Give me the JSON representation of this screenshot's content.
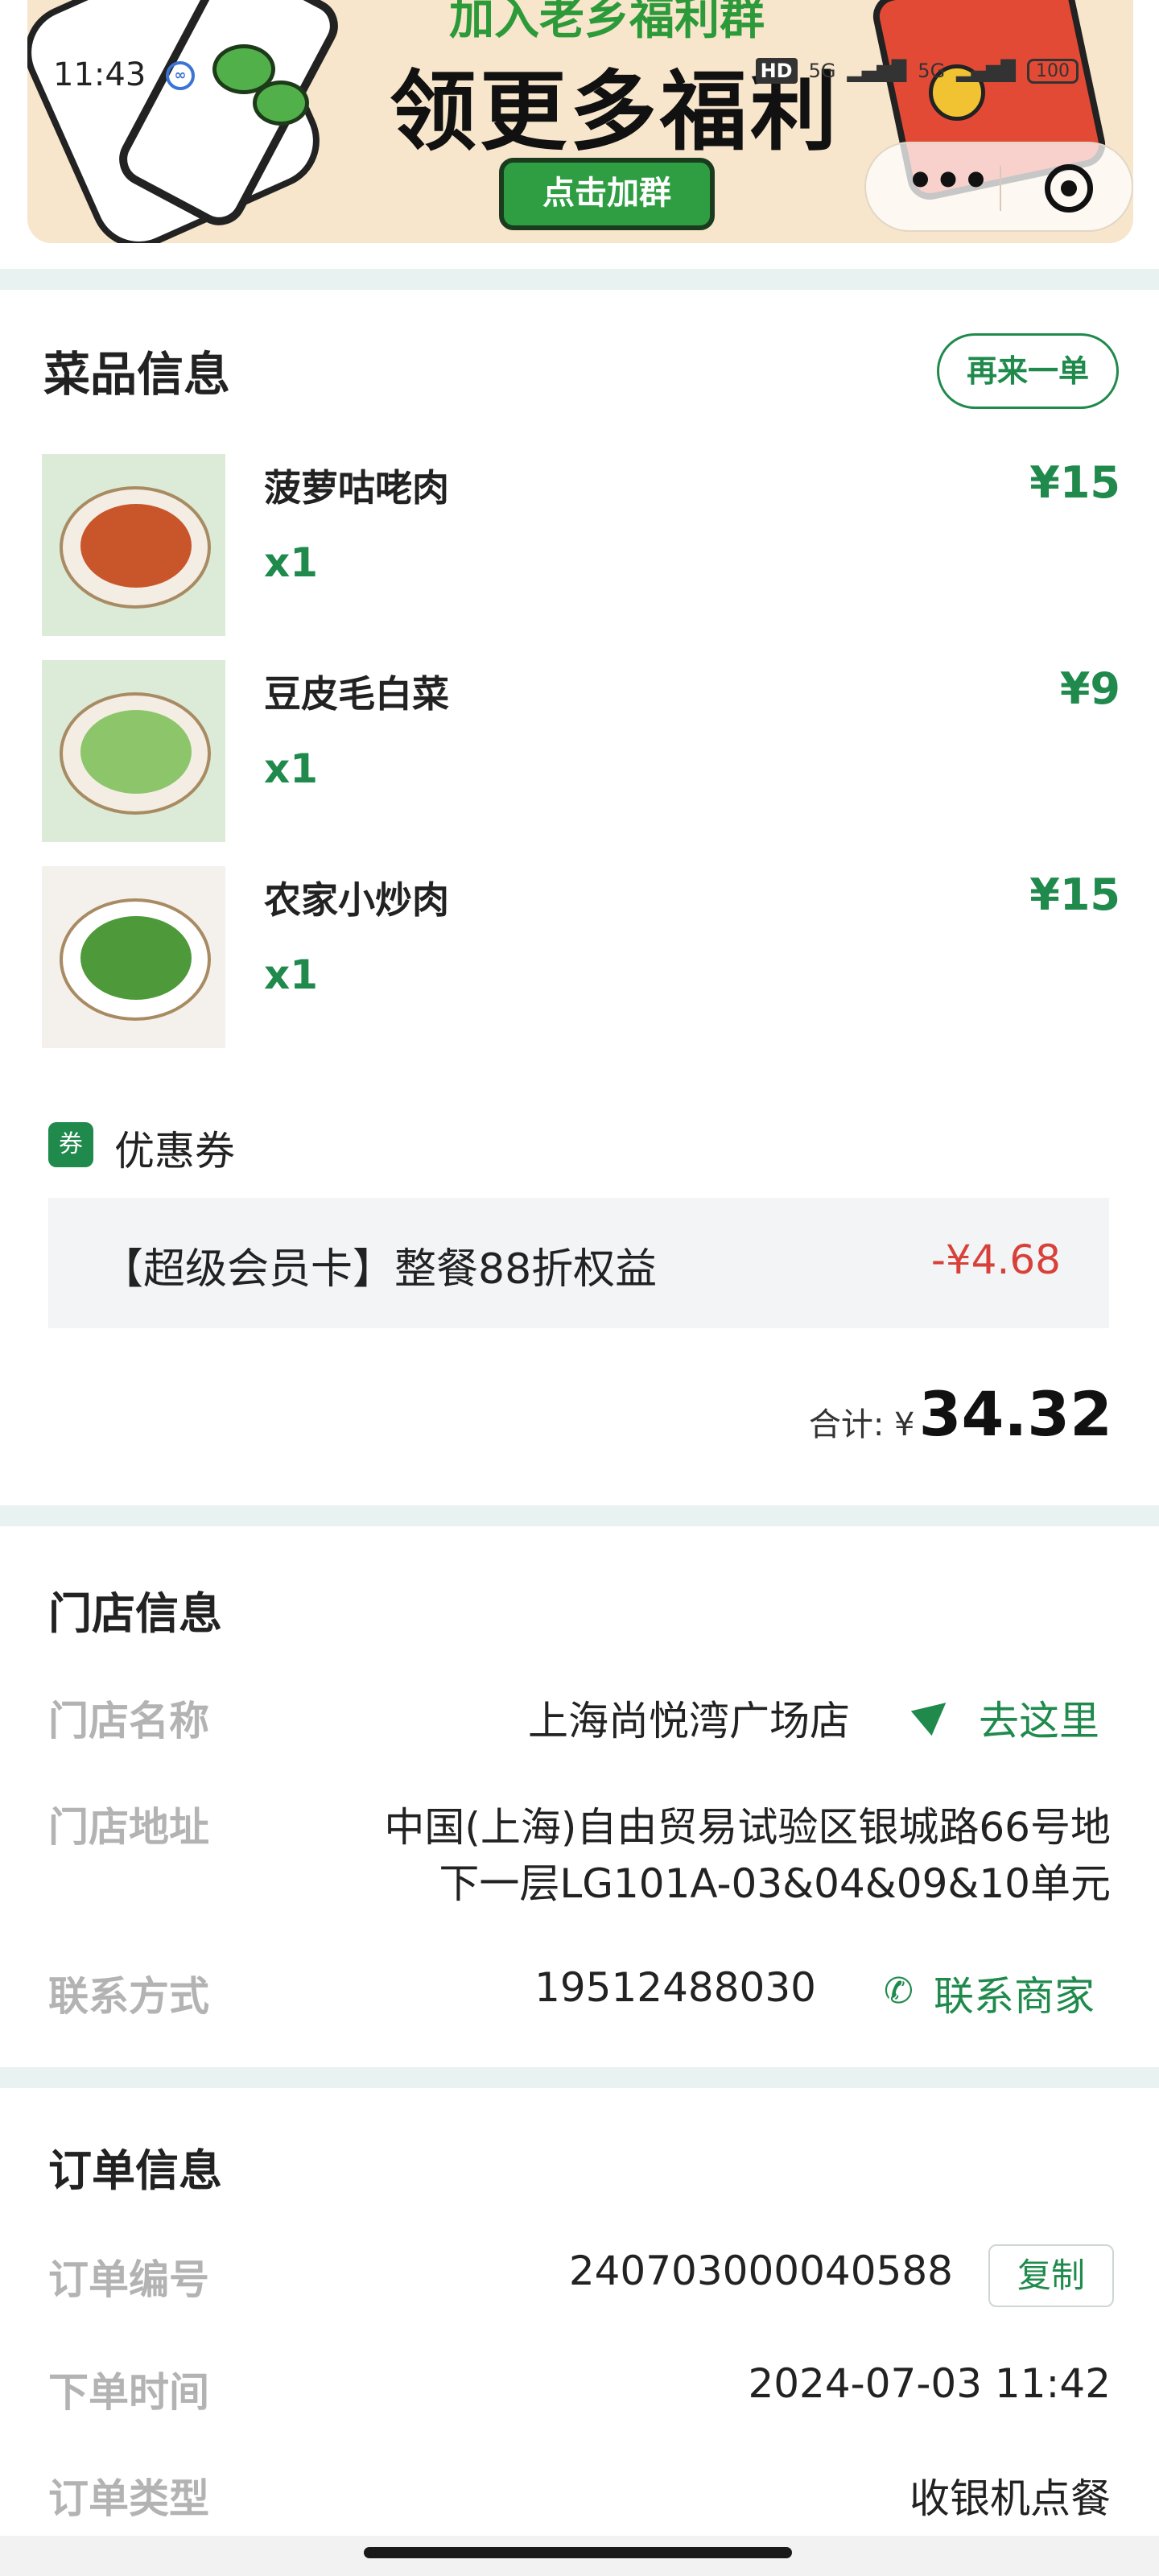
{
  "status_bar": {
    "time": "11:43",
    "network_labels": [
      "HD",
      "5G",
      "5G"
    ],
    "battery": "100"
  },
  "banner": {
    "headline_top": "加入老乡福利群",
    "headline": "领更多福利",
    "join_button": "点击加群"
  },
  "capsule": {
    "more_label": "•••"
  },
  "dishes_section": {
    "title": "菜品信息",
    "reorder_button": "再来一单",
    "items": [
      {
        "name": "菠萝咕咾肉",
        "qty": "x1",
        "price": "¥15",
        "food_color": "#c9552a"
      },
      {
        "name": "豆皮毛白菜",
        "qty": "x1",
        "price": "¥9",
        "food_color": "#8cc56a"
      },
      {
        "name": "农家小炒肉",
        "qty": "x1",
        "price": "¥15",
        "food_color": "#4e9a3a"
      }
    ]
  },
  "coupon": {
    "badge": "券",
    "label": "优惠券",
    "description": "【超级会员卡】整餐88折权益",
    "amount": "-¥4.68"
  },
  "total": {
    "label": "合计: ¥",
    "value": "34.32"
  },
  "store_info": {
    "title": "门店信息",
    "name_label": "门店名称",
    "name_value": "上海尚悦湾广场店",
    "navigate_label": "去这里",
    "address_label": "门店地址",
    "address_line1": "中国(上海)自由贸易试验区银城路66号地",
    "address_line2": "下一层LG101A-03&04&09&10单元",
    "contact_label": "联系方式",
    "contact_value": "19512488030",
    "contact_link": "联系商家"
  },
  "order_info": {
    "title": "订单信息",
    "number_label": "订单编号",
    "number_value": "240703000040588",
    "copy_button": "复制",
    "time_label": "下单时间",
    "time_value": "2024-07-03 11:42",
    "type_label": "订单类型",
    "type_value": "收银机点餐"
  },
  "colors": {
    "brand_green": "#1f8a4c",
    "discount_red": "#d8413a",
    "divider": "#e8f2f0"
  }
}
